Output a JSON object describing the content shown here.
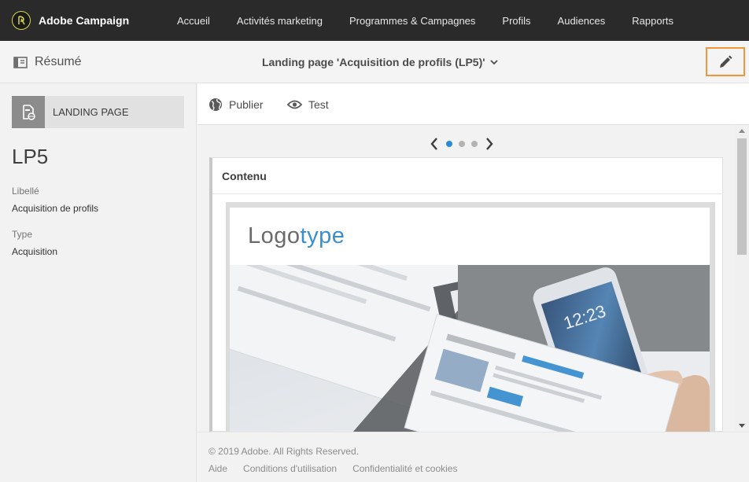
{
  "app": {
    "name": "Adobe Campaign"
  },
  "nav": {
    "items": [
      {
        "label": "Accueil"
      },
      {
        "label": "Activités marketing"
      },
      {
        "label": "Programmes & Campagnes"
      },
      {
        "label": "Profils"
      },
      {
        "label": "Audiences"
      },
      {
        "label": "Rapports"
      }
    ]
  },
  "subheader": {
    "summary_label": "Résumé",
    "title": "Landing page 'Acquisition de profils (LP5)'",
    "edit_icon": "pencil-icon",
    "edit_highlight_color": "#f0963c"
  },
  "left_panel": {
    "badge_label": "LANDING PAGE",
    "name": "LP5",
    "fields": [
      {
        "label": "Libellé",
        "value": "Acquisition de profils"
      },
      {
        "label": "Type",
        "value": "Acquisition"
      }
    ]
  },
  "toolbar": {
    "publish_label": "Publier",
    "test_label": "Test"
  },
  "carousel": {
    "pages": 3,
    "active_index": 0,
    "active_color": "#2d8ad8"
  },
  "content": {
    "title": "Contenu",
    "logo_part1": "Logo",
    "logo_part2": "type",
    "logo_color_1": "#6a6a6a",
    "logo_color_2": "#3a8ed0"
  },
  "footer": {
    "copyright": "© 2019 Adobe. All Rights Reserved.",
    "links": [
      "Aide",
      "Conditions d'utilisation",
      "Confidentialité et cookies"
    ]
  }
}
